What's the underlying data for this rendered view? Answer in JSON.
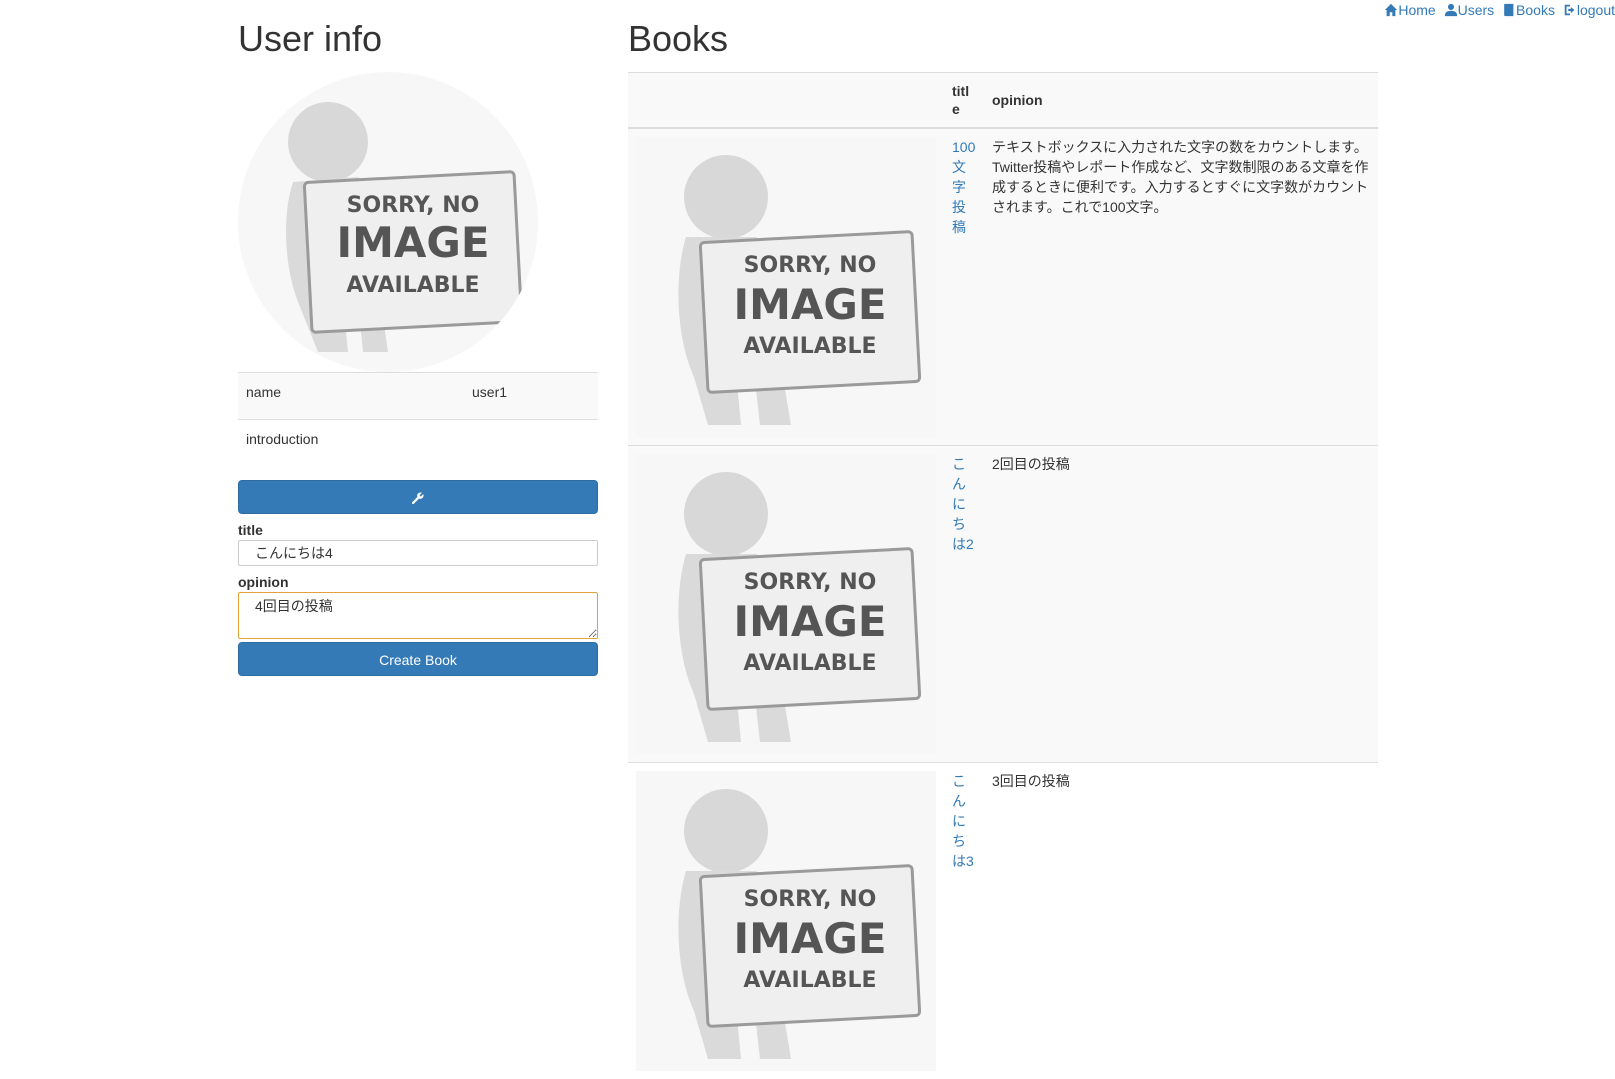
{
  "nav": {
    "home": "Home",
    "users": "Users",
    "books": "Books",
    "logout": "logout"
  },
  "user_info": {
    "heading": "User info",
    "rows": [
      {
        "label": "name",
        "value": "user1"
      },
      {
        "label": "introduction",
        "value": ""
      }
    ],
    "edit_icon": "wrench-icon"
  },
  "form": {
    "title_label": "title",
    "title_value": "こんにちは4",
    "opinion_label": "opinion",
    "opinion_value": "4回目の投稿",
    "submit_label": "Create Book"
  },
  "books": {
    "heading": "Books",
    "columns": [
      "",
      "title",
      "opinion"
    ],
    "rows": [
      {
        "title": "100文字投稿",
        "opinion": "テキストボックスに入力された文字の数をカウントします。 Twitter投稿やレポート作成など、文字数制限のある文章を作成するときに便利です。入力するとすぐに文字数がカウントされます。これで100文字。"
      },
      {
        "title": "こんにちは2",
        "opinion": "2回目の投稿"
      },
      {
        "title": "こんにちは3",
        "opinion": "3回目の投稿"
      }
    ]
  },
  "no_image": {
    "line1": "SORRY, NO",
    "line2": "IMAGE",
    "line3": "AVAILABLE"
  }
}
